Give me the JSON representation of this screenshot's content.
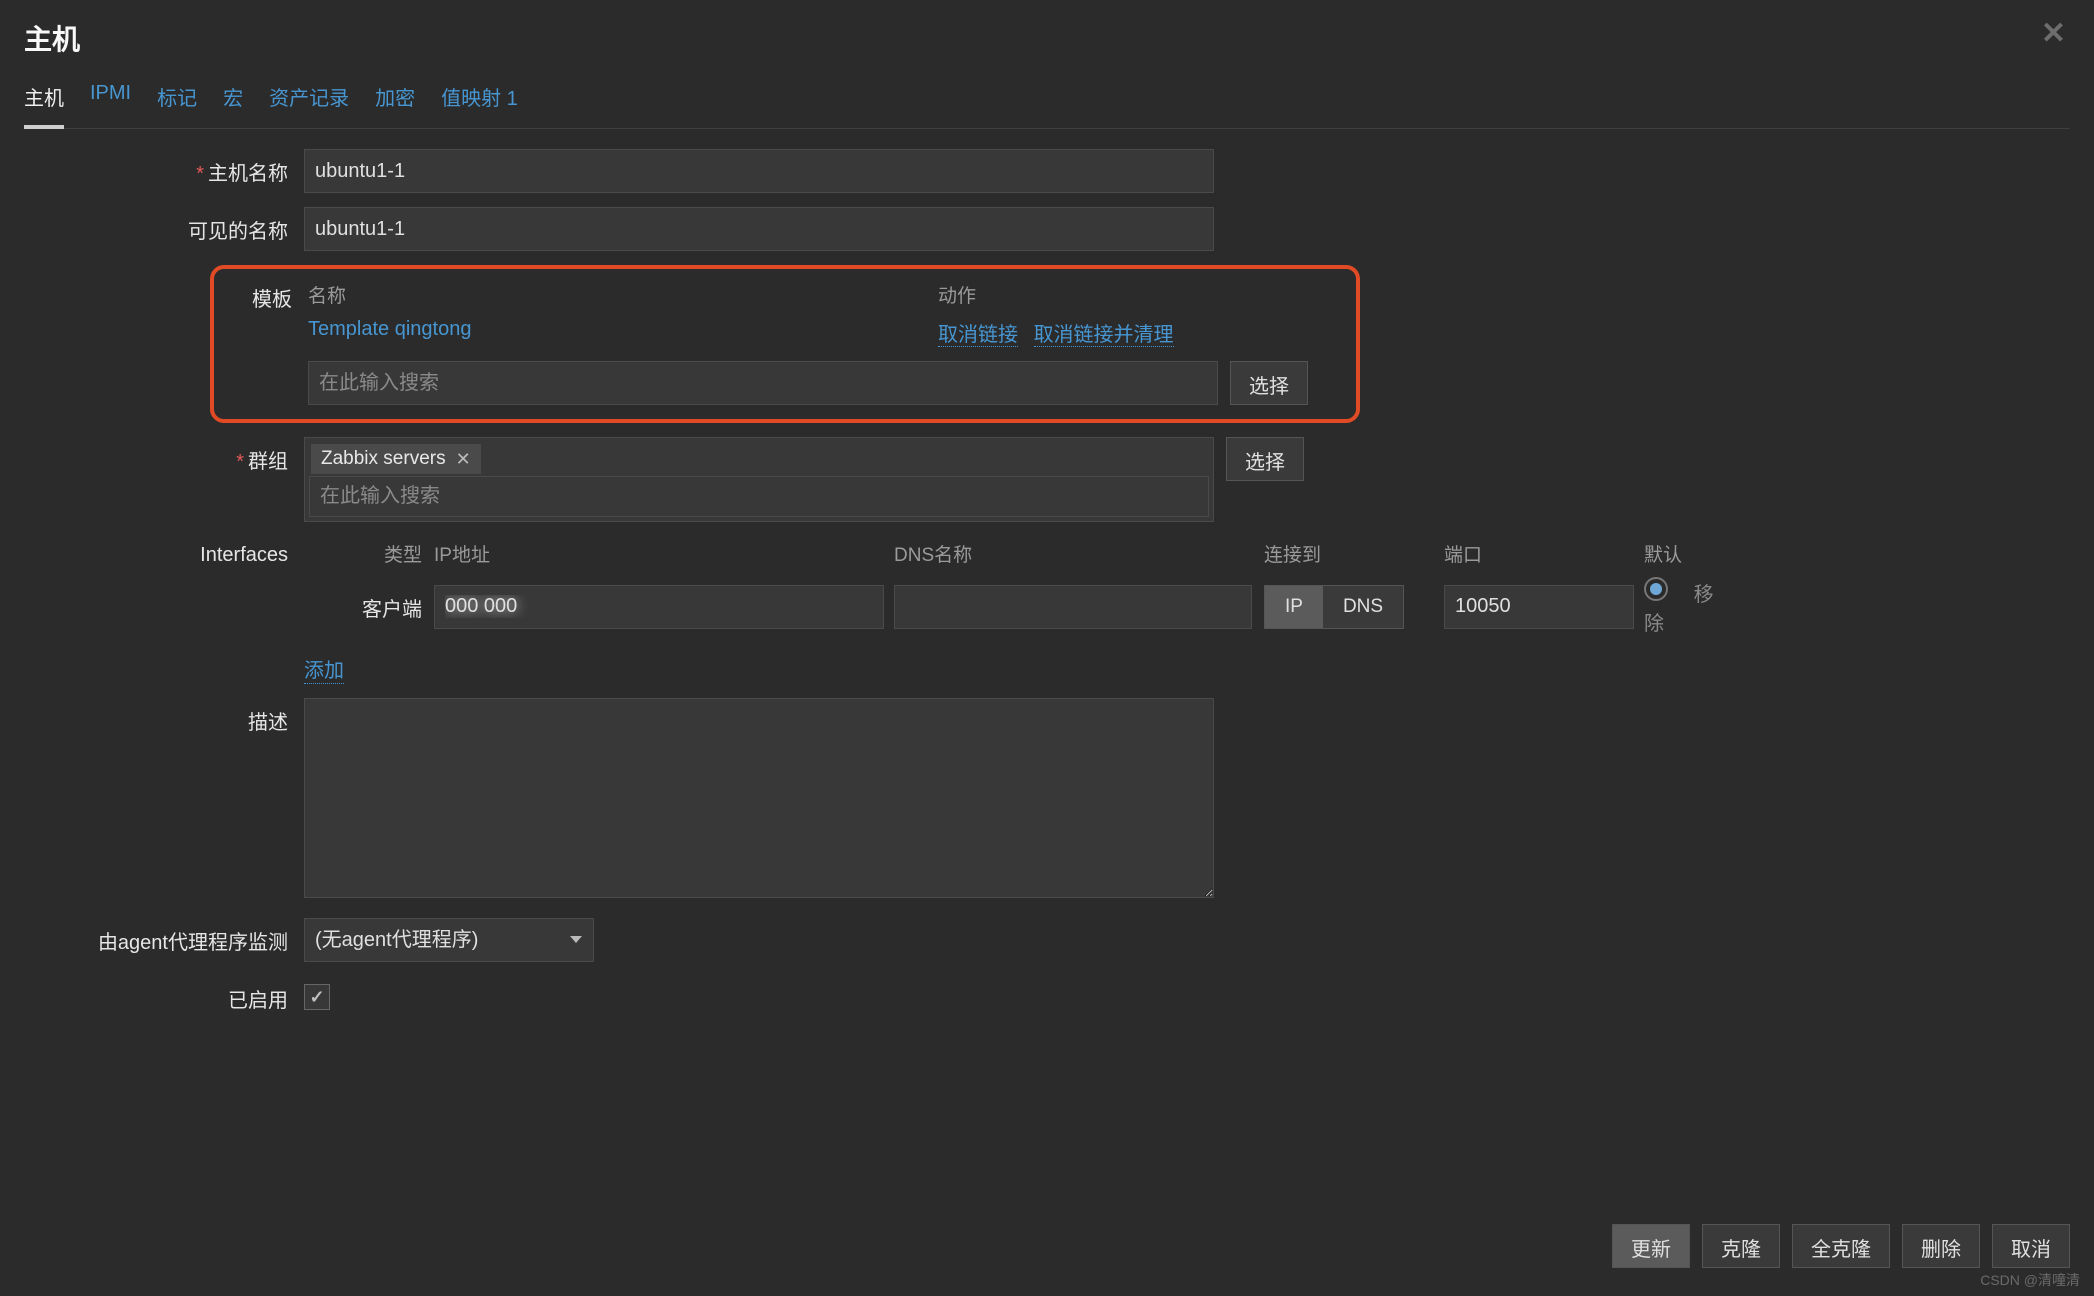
{
  "dialog": {
    "title": "主机",
    "close_icon": "✕"
  },
  "tabs": [
    {
      "label": "主机",
      "active": true
    },
    {
      "label": "IPMI"
    },
    {
      "label": "标记"
    },
    {
      "label": "宏"
    },
    {
      "label": "资产记录"
    },
    {
      "label": "加密"
    },
    {
      "label": "值映射 1"
    }
  ],
  "fields": {
    "host_name": {
      "label": "主机名称",
      "value": "ubuntu1-1",
      "required": true
    },
    "visible_name": {
      "label": "可见的名称",
      "value": "ubuntu1-1"
    },
    "templates": {
      "label": "模板",
      "col_name": "名称",
      "col_action": "动作",
      "linked": [
        {
          "name": "Template qingtong",
          "unlink": "取消链接",
          "unlink_clear": "取消链接并清理"
        }
      ],
      "search_placeholder": "在此输入搜索",
      "select_btn": "选择"
    },
    "groups": {
      "label": "群组",
      "required": true,
      "tags": [
        "Zabbix servers"
      ],
      "search_placeholder": "在此输入搜索",
      "select_btn": "选择"
    },
    "interfaces": {
      "label": "Interfaces",
      "headers": {
        "type": "类型",
        "ip": "IP地址",
        "dns": "DNS名称",
        "conn": "连接到",
        "port": "端口",
        "def": "默认"
      },
      "rows": [
        {
          "type": "客户端",
          "ip": "",
          "dns": "",
          "conn_ip": "IP",
          "conn_dns": "DNS",
          "conn_active": "IP",
          "port": "10050",
          "default_checked": true,
          "remove": "移除"
        }
      ],
      "add": "添加"
    },
    "description": {
      "label": "描述",
      "value": ""
    },
    "proxy": {
      "label": "由agent代理程序监测",
      "value": "(无agent代理程序)"
    },
    "enabled": {
      "label": "已启用",
      "checked": true
    }
  },
  "footer": {
    "update": "更新",
    "clone": "克隆",
    "full_clone": "全克隆",
    "delete": "删除",
    "cancel": "取消"
  },
  "watermark": "CSDN @清噇清"
}
